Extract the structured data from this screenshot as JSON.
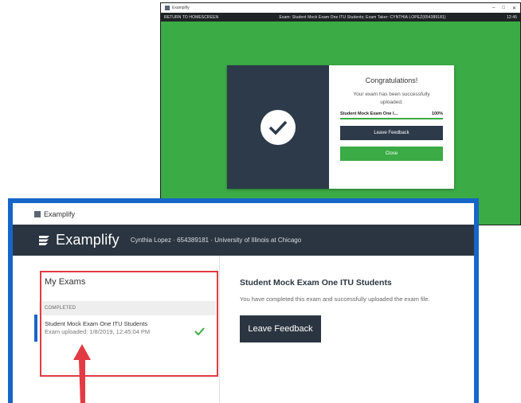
{
  "colors": {
    "success_green": "#3bab45",
    "navy": "#2b3541",
    "frame_blue": "#1566c8",
    "annotation_red": "#e23b44"
  },
  "upload_window": {
    "title": "Examplify",
    "return_link": "RETURN TO HOMESCREEN",
    "exam_info": "Exam: Student Mock Exam One ITU Students; Exam Taker: CYNTHIA LOPEZ(654389181)",
    "time": "12:45",
    "dialog": {
      "heading": "Congratulations!",
      "message": "Your exam has been successfully uploaded.",
      "progress_label": "Student Mock Exam One I...",
      "progress_percent": "100%",
      "progress_value": 1.0,
      "leave_feedback_label": "Leave Feedback",
      "close_label": "Close",
      "icon": "checkmark-icon"
    }
  },
  "main_window": {
    "title": "Examplify",
    "brand": "Examplify",
    "user_info": "Cynthia Lopez · 654389181 · University of Illinois at Chicago",
    "sidebar": {
      "title": "My Exams",
      "section_label": "COMPLETED",
      "exam": {
        "name": "Student Mock Exam One ITU Students",
        "uploaded": "Exam uploaded: 1/8/2019, 12:45:04 PM",
        "status_icon": "checkmark-icon"
      }
    },
    "detail": {
      "heading": "Student Mock Exam One ITU Students",
      "description": "You have completed this exam and successfully uploaded the exam file.",
      "leave_feedback_label": "Leave Feedback"
    }
  }
}
